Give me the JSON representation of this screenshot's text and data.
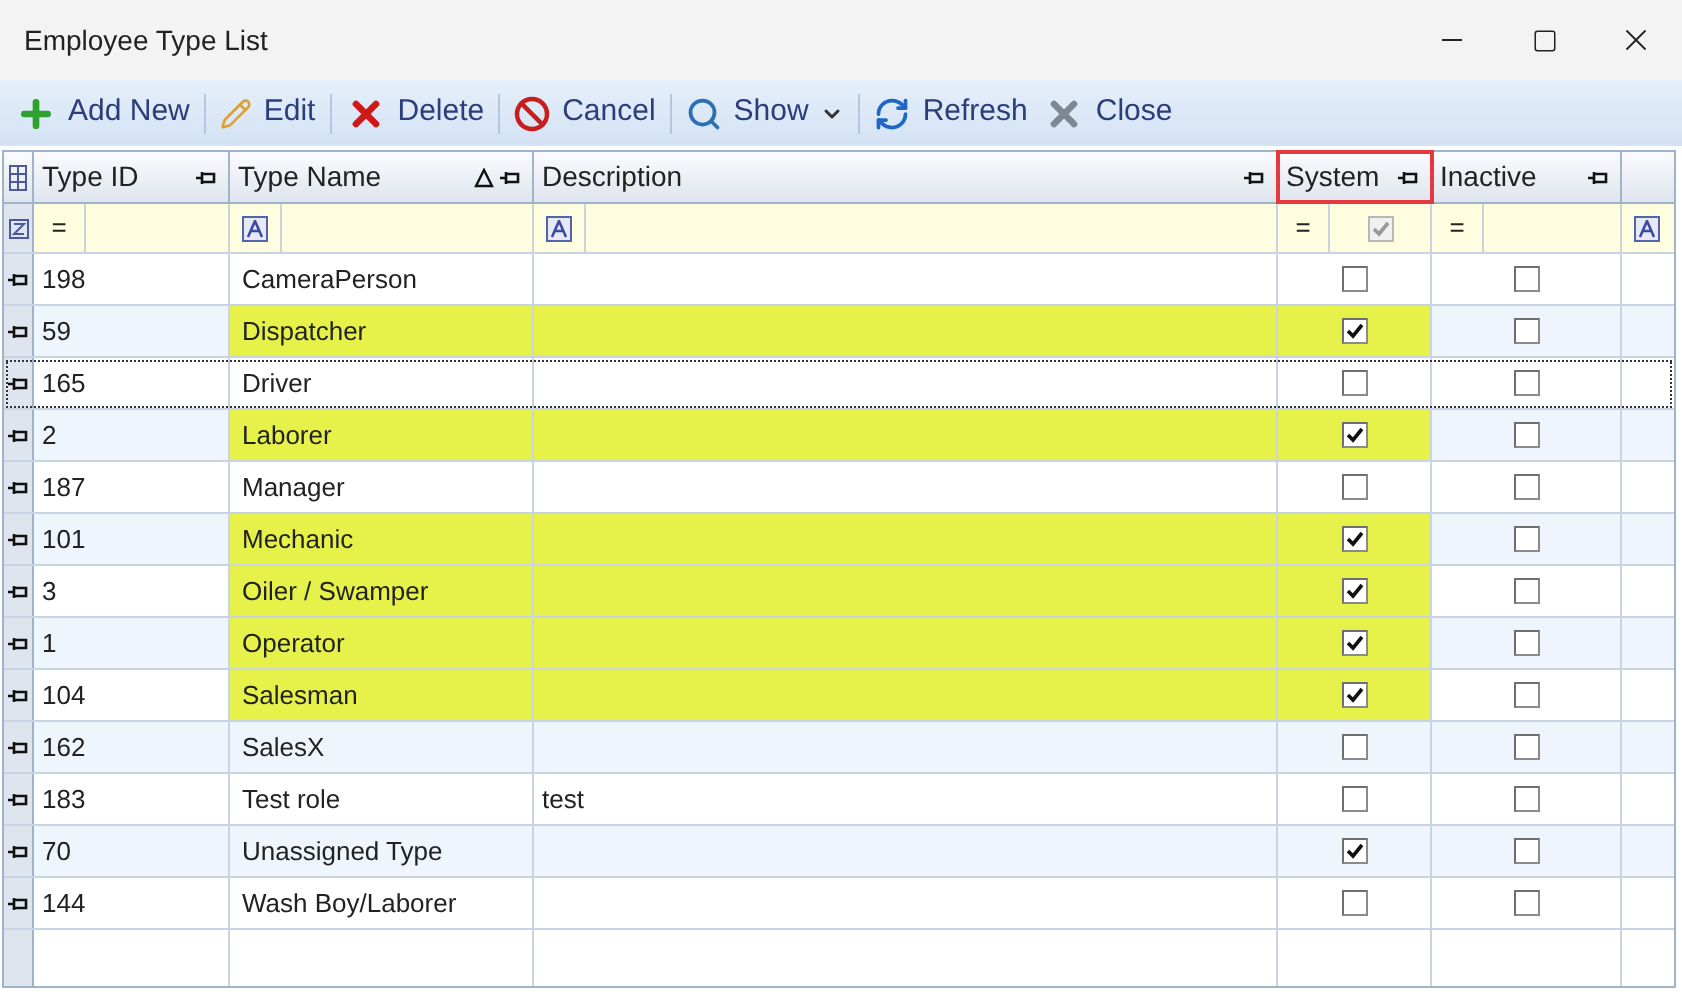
{
  "window": {
    "title": "Employee Type List"
  },
  "toolbar": [
    {
      "label": "Add New",
      "kind": "add"
    },
    {
      "label": "Edit",
      "kind": "edit"
    },
    {
      "label": "Delete",
      "kind": "delete"
    },
    {
      "label": "Cancel",
      "kind": "cancel"
    },
    {
      "label": "Show",
      "kind": "show"
    },
    {
      "label": "Refresh",
      "kind": "refresh"
    },
    {
      "label": "Close",
      "kind": "close"
    }
  ],
  "columns": [
    {
      "label": "Type ID",
      "sorted": false,
      "outlined": false,
      "filter_op": "=",
      "filter_checkbox": false
    },
    {
      "label": "Type Name",
      "sorted": true,
      "outlined": false,
      "filter_checkbox": false
    },
    {
      "label": "Description",
      "sorted": false,
      "outlined": false,
      "filter_checkbox": false
    },
    {
      "label": "System",
      "sorted": false,
      "outlined": true,
      "filter_op": "=",
      "filter_checkbox": true
    },
    {
      "label": "Inactive",
      "sorted": false,
      "outlined": false,
      "filter_op": "=",
      "filter_checkbox": false
    }
  ],
  "rows": [
    {
      "id": "198",
      "name": "CameraPerson",
      "description": "",
      "system": false,
      "inactive": false,
      "highlighted": false,
      "focused": false
    },
    {
      "id": "59",
      "name": "Dispatcher",
      "description": "",
      "system": true,
      "inactive": false,
      "highlighted": true,
      "focused": false
    },
    {
      "id": "165",
      "name": "Driver",
      "description": "",
      "system": false,
      "inactive": false,
      "highlighted": false,
      "focused": true
    },
    {
      "id": "2",
      "name": "Laborer",
      "description": "",
      "system": true,
      "inactive": false,
      "highlighted": true,
      "focused": false
    },
    {
      "id": "187",
      "name": "Manager",
      "description": "",
      "system": false,
      "inactive": false,
      "highlighted": false,
      "focused": false
    },
    {
      "id": "101",
      "name": "Mechanic",
      "description": "",
      "system": true,
      "inactive": false,
      "highlighted": true,
      "focused": false
    },
    {
      "id": "3",
      "name": "Oiler / Swamper",
      "description": "",
      "system": true,
      "inactive": false,
      "highlighted": true,
      "focused": false
    },
    {
      "id": "1",
      "name": "Operator",
      "description": "",
      "system": true,
      "inactive": false,
      "highlighted": true,
      "focused": false
    },
    {
      "id": "104",
      "name": "Salesman",
      "description": "",
      "system": true,
      "inactive": false,
      "highlighted": true,
      "focused": false
    },
    {
      "id": "162",
      "name": "SalesX",
      "description": "",
      "system": false,
      "inactive": false,
      "highlighted": false,
      "focused": false
    },
    {
      "id": "183",
      "name": "Test role",
      "description": "test",
      "system": false,
      "inactive": false,
      "highlighted": false,
      "focused": false
    },
    {
      "id": "70",
      "name": "Unassigned Type",
      "description": "",
      "system": true,
      "inactive": false,
      "highlighted": false,
      "focused": false
    },
    {
      "id": "144",
      "name": "Wash Boy/Laborer",
      "description": "",
      "system": false,
      "inactive": false,
      "highlighted": false,
      "focused": false
    }
  ]
}
